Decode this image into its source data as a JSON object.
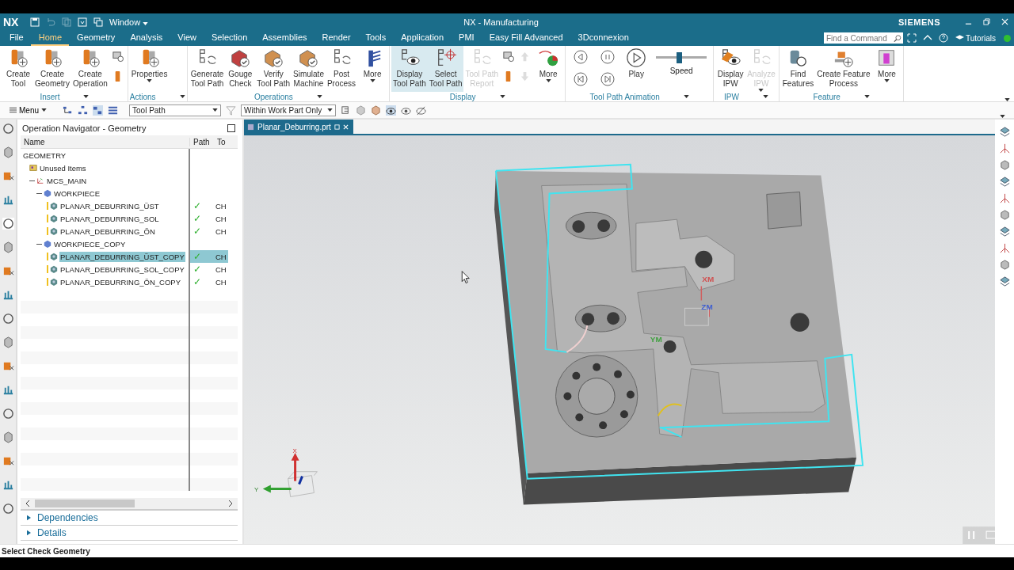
{
  "title_bar": {
    "logo": "NX",
    "window_menu": "Window",
    "title": "NX - Manufacturing",
    "brand": "SIEMENS"
  },
  "menu_tabs": [
    {
      "label": "File",
      "selected": false
    },
    {
      "label": "Home",
      "selected": true
    },
    {
      "label": "Geometry",
      "selected": false
    },
    {
      "label": "Analysis",
      "selected": false
    },
    {
      "label": "View",
      "selected": false
    },
    {
      "label": "Selection",
      "selected": false
    },
    {
      "label": "Assemblies",
      "selected": false
    },
    {
      "label": "Render",
      "selected": false
    },
    {
      "label": "Tools",
      "selected": false
    },
    {
      "label": "Application",
      "selected": false
    },
    {
      "label": "PMI",
      "selected": false
    },
    {
      "label": "Easy Fill Advanced",
      "selected": false
    },
    {
      "label": "3Dconnexion",
      "selected": false
    }
  ],
  "command_search": {
    "placeholder": "Find a Command"
  },
  "tutorials": "Tutorials",
  "ribbon_groups": [
    {
      "label": "Insert",
      "items": [
        {
          "kind": "large",
          "label": "Create\nTool",
          "selected": false,
          "disabled": false
        },
        {
          "kind": "large",
          "label": "Create\nGeometry",
          "selected": false,
          "disabled": false
        },
        {
          "kind": "large",
          "label": "Create\nOperation",
          "selected": false,
          "disabled": false
        },
        {
          "kind": "icon_stack"
        }
      ]
    },
    {
      "label": "Actions",
      "items": [
        {
          "kind": "large",
          "label": "Properties",
          "dropdown": true,
          "selected": false,
          "disabled": false
        }
      ]
    },
    {
      "label": "Operations",
      "items": [
        {
          "kind": "large",
          "label": "Generate\nTool Path",
          "selected": false,
          "disabled": false
        },
        {
          "kind": "large",
          "label": "Gouge\nCheck",
          "selected": false,
          "disabled": false
        },
        {
          "kind": "large",
          "label": "Verify\nTool Path",
          "selected": false,
          "disabled": false
        },
        {
          "kind": "large",
          "label": "Simulate\nMachine",
          "selected": false,
          "disabled": false
        },
        {
          "kind": "large",
          "label": "Post\nProcess",
          "selected": false,
          "disabled": false
        },
        {
          "kind": "large",
          "label": "More",
          "dropdown": true,
          "selected": false,
          "disabled": false
        }
      ]
    },
    {
      "label": "Display",
      "items": [
        {
          "kind": "large",
          "label": "Display\nTool Path",
          "selected": true,
          "disabled": false
        },
        {
          "kind": "large",
          "label": "Select\nTool Path",
          "selected": true,
          "disabled": false
        },
        {
          "kind": "large",
          "label": "Tool Path\nReport",
          "selected": false,
          "disabled": true
        },
        {
          "kind": "icon_stack"
        },
        {
          "kind": "arrow_stack"
        },
        {
          "kind": "large",
          "label": "More",
          "dropdown": true,
          "selected": false,
          "disabled": false
        }
      ]
    },
    {
      "label": "Tool Path Animation",
      "items": [
        {
          "kind": "animation_controls"
        },
        {
          "kind": "large",
          "label": "Play",
          "selected": false,
          "disabled": false
        },
        {
          "kind": "slider",
          "label": "Speed",
          "level": 0.45
        }
      ]
    },
    {
      "label": "IPW",
      "items": [
        {
          "kind": "large",
          "label": "Display\nIPW",
          "selected": false,
          "disabled": false
        },
        {
          "kind": "large",
          "label": "Analyze\nIPW",
          "dropdown": true,
          "selected": false,
          "disabled": true
        }
      ]
    },
    {
      "label": "Feature",
      "items": [
        {
          "kind": "large",
          "label": "Find\nFeatures",
          "selected": false,
          "disabled": false
        },
        {
          "kind": "large",
          "label": "Create Feature\nProcess",
          "selected": false,
          "disabled": false
        },
        {
          "kind": "large",
          "label": "More",
          "dropdown": true,
          "selected": false,
          "disabled": false
        }
      ]
    }
  ],
  "toolbar": {
    "menu": "Menu",
    "type_filter": "Tool Path",
    "scope": "Within Work Part Only"
  },
  "navigator": {
    "title": "Operation Navigator - Geometry",
    "columns": [
      "Name",
      "Path",
      "To"
    ],
    "tree": [
      {
        "label": "GEOMETRY",
        "selected": false,
        "children": [
          {
            "label": "Unused Items",
            "kind": "folder",
            "selected": false
          },
          {
            "label": "MCS_MAIN",
            "kind": "mcs",
            "expanded": true,
            "selected": false,
            "children": [
              {
                "label": "WORKPIECE",
                "kind": "workpiece",
                "expanded": true,
                "selected": false,
                "children": [
                  {
                    "label": "PLANAR_DEBURRING_ÜST",
                    "kind": "operation",
                    "path": "✓",
                    "tool": "CH",
                    "selected": false
                  },
                  {
                    "label": "PLANAR_DEBURRING_SOL",
                    "kind": "operation",
                    "path": "✓",
                    "tool": "CH",
                    "selected": false
                  },
                  {
                    "label": "PLANAR_DEBURRING_ÖN",
                    "kind": "operation",
                    "path": "✓",
                    "tool": "CH",
                    "selected": false
                  }
                ]
              },
              {
                "label": "WORKPIECE_COPY",
                "kind": "workpiece",
                "expanded": true,
                "selected": false,
                "children": [
                  {
                    "label": "PLANAR_DEBURRING_ÜST_COPY",
                    "kind": "operation",
                    "path": "✓",
                    "tool": "CH",
                    "selected": true
                  },
                  {
                    "label": "PLANAR_DEBURRING_SOL_COPY",
                    "kind": "operation",
                    "path": "✓",
                    "tool": "CH",
                    "selected": false
                  },
                  {
                    "label": "PLANAR_DEBURRING_ÖN_COPY",
                    "kind": "operation",
                    "path": "✓",
                    "tool": "CH",
                    "selected": false
                  }
                ]
              }
            ]
          }
        ]
      }
    ],
    "sections": [
      {
        "label": "Dependencies",
        "expanded": false
      },
      {
        "label": "Details",
        "expanded": false
      }
    ]
  },
  "viewport": {
    "tab": "Planar_Deburring.prt",
    "labels": [
      {
        "text": "XM",
        "color": "#d05050"
      },
      {
        "text": "ZM",
        "color": "#4060d0"
      },
      {
        "text": "YM",
        "color": "#40a040"
      }
    ],
    "triad": {
      "x": "X",
      "y": "Y"
    }
  },
  "status_bar": "Select Check Geometry"
}
